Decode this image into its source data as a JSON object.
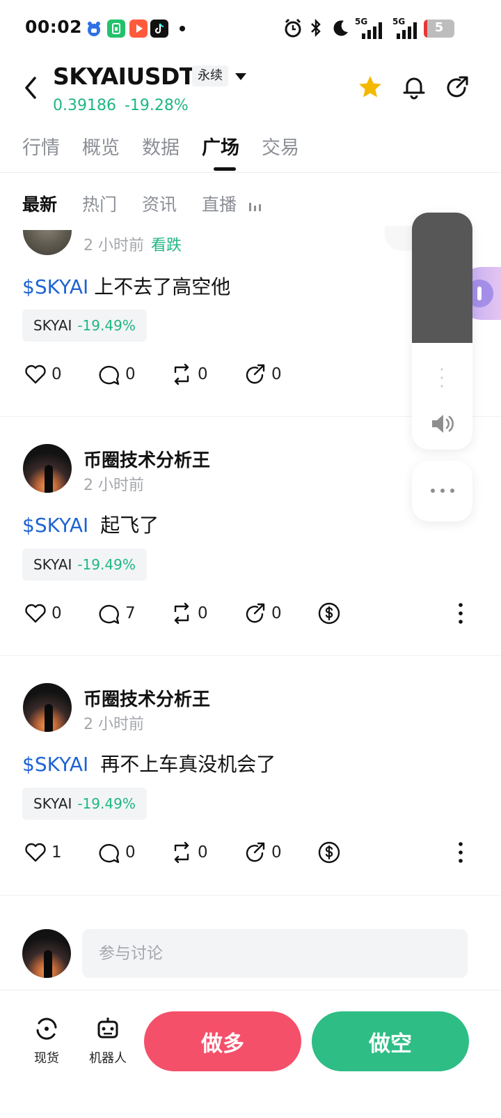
{
  "status_bar": {
    "time": "00:02",
    "battery": "5",
    "network_1": "5G",
    "network_2": "5G",
    "icons": [
      "baidu-app-icon",
      "green-app-icon",
      "video-app-icon",
      "tiktok-icon",
      "alarm-icon",
      "bluetooth-icon",
      "moon-icon",
      "signal-icon",
      "battery-icon"
    ]
  },
  "header": {
    "pair": "SKYAIUSDT",
    "contract_type": "永续",
    "price": "0.39186",
    "change": "-19.28%",
    "icons": [
      "back-icon",
      "chevron-down-icon",
      "star-icon",
      "bell-icon",
      "share-icon"
    ],
    "colors": {
      "up_green": "#1fb781",
      "star": "#f5b800"
    }
  },
  "main_tabs": {
    "items": [
      "行情",
      "概览",
      "数据",
      "广场",
      "交易"
    ],
    "active_index": 3
  },
  "sub_tabs": {
    "items": [
      "最新",
      "热门",
      "资讯",
      "直播"
    ],
    "active_index": 0
  },
  "posts": [
    {
      "time": "2 小时前",
      "sentiment": "看跌",
      "ticker": "$SKYAI",
      "text": "上不去了高空他",
      "chip_name": "SKYAI",
      "chip_change": "-19.49%",
      "likes": "0",
      "comments": "0",
      "reposts": "0",
      "shares": "0"
    },
    {
      "author": "币圈技术分析王",
      "time": "2 小时前",
      "ticker": "$SKYAI",
      "text": "起飞了",
      "chip_name": "SKYAI",
      "chip_change": "-19.49%",
      "likes": "0",
      "comments": "7",
      "reposts": "0",
      "shares": "0"
    },
    {
      "author": "币圈技术分析王",
      "time": "2 小时前",
      "ticker": "$SKYAI",
      "text": "再不上车真没机会了",
      "chip_name": "SKYAI",
      "chip_change": "-19.49%",
      "likes": "1",
      "comments": "0",
      "reposts": "0",
      "shares": "0"
    }
  ],
  "volume_overlay": {
    "level": 0.55,
    "icons": [
      "speaker-icon",
      "more-horizontal-icon"
    ]
  },
  "comment_bar": {
    "placeholder": "参与讨论"
  },
  "bottom_bar": {
    "spot_label": "现货",
    "bot_label": "机器人",
    "long_label": "做多",
    "short_label": "做空",
    "colors": {
      "long": "#f4506a",
      "short": "#2ebd85"
    }
  }
}
